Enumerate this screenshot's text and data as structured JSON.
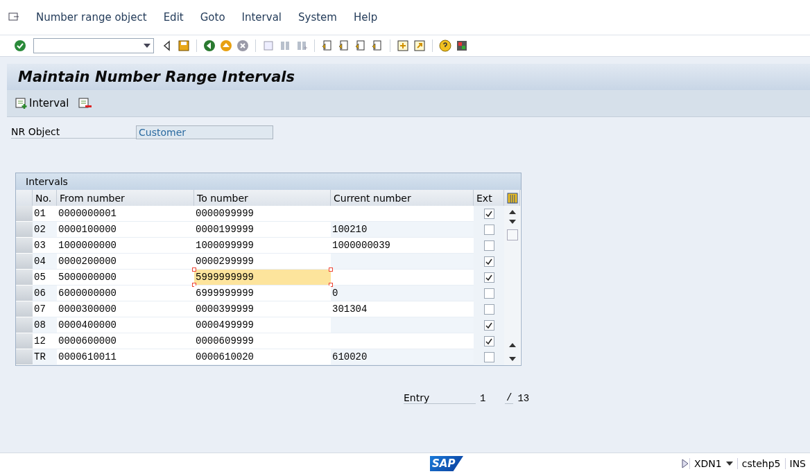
{
  "menu": [
    "Number range object",
    "Edit",
    "Goto",
    "Interval",
    "System",
    "Help"
  ],
  "title": "Maintain Number Range Intervals",
  "app_toolbar": {
    "interval_button": "Interval"
  },
  "nr_object": {
    "label": "NR Object",
    "value": "Customer"
  },
  "table": {
    "title": "Intervals",
    "columns": [
      "No.",
      "From number",
      "To number",
      "Current number",
      "Ext"
    ],
    "rows": [
      {
        "no": "01",
        "from": "0000000001",
        "to": "0000099999",
        "current": "",
        "ext": true,
        "editing": false
      },
      {
        "no": "02",
        "from": "0000100000",
        "to": "0000199999",
        "current": "100210",
        "ext": false,
        "editing": false
      },
      {
        "no": "03",
        "from": "1000000000",
        "to": "1000099999",
        "current": "1000000039",
        "ext": false,
        "editing": false
      },
      {
        "no": "04",
        "from": "0000200000",
        "to": "0000299999",
        "current": "",
        "ext": true,
        "editing": false
      },
      {
        "no": "05",
        "from": "5000000000",
        "to": "5999999999",
        "current": "",
        "ext": true,
        "editing": true
      },
      {
        "no": "06",
        "from": "6000000000",
        "to": "6999999999",
        "current": "0",
        "ext": false,
        "editing": false
      },
      {
        "no": "07",
        "from": "0000300000",
        "to": "0000399999",
        "current": "301304",
        "ext": false,
        "editing": false
      },
      {
        "no": "08",
        "from": "0000400000",
        "to": "0000499999",
        "current": "",
        "ext": true,
        "editing": false
      },
      {
        "no": "12",
        "from": "0000600000",
        "to": "0000609999",
        "current": "",
        "ext": true,
        "editing": false
      },
      {
        "no": "TR",
        "from": "0000610011",
        "to": "0000610020",
        "current": "610020",
        "ext": false,
        "editing": false
      }
    ]
  },
  "entry": {
    "label": "Entry",
    "value": "1",
    "separator": "/",
    "total": "13"
  },
  "status_bar": {
    "logo": "SAP",
    "system": "XDN1",
    "server": "cstehp5",
    "mode": "INS"
  }
}
